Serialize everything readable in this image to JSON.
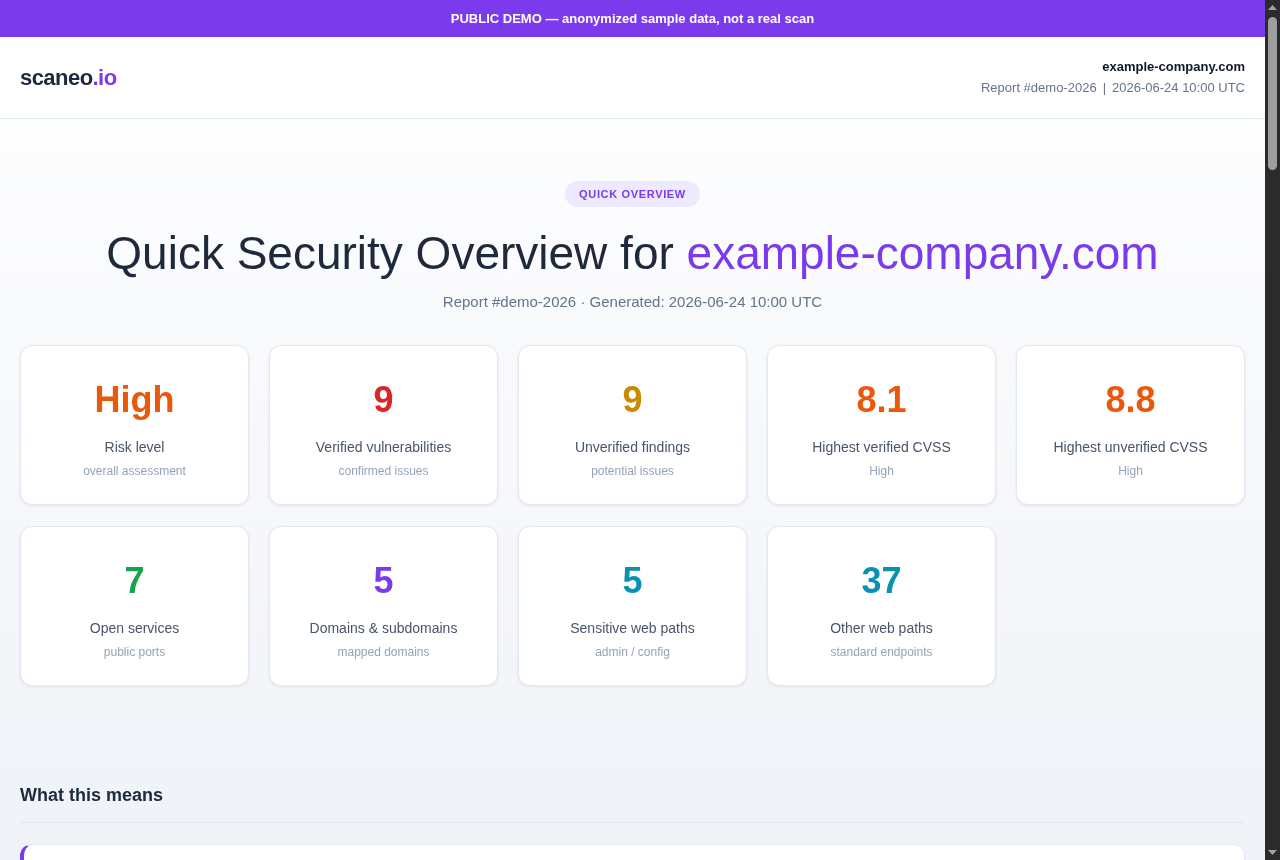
{
  "banner": {
    "text": "PUBLIC DEMO — anonymized sample data, not a real scan"
  },
  "header": {
    "logo": {
      "name": "scaneo",
      "tld": ".io"
    },
    "domain": "example-company.com",
    "meta": [
      "Report #demo-2026",
      "2026-06-24 10:00 UTC"
    ],
    "meta_separator": "|"
  },
  "hero": {
    "badge": "QUICK OVERVIEW",
    "title": "Quick Security Overview for",
    "title_domain": "example-company.com",
    "subtitle": "Report #demo-2026 · Generated: 2026-06-24 10:00 UTC"
  },
  "stats": [
    {
      "value": "High",
      "label": "Risk level",
      "note": "overall assessment",
      "color": "#ea580c"
    },
    {
      "value": "9",
      "label": "Verified vulnerabilities",
      "note": "confirmed issues",
      "color": "#dc2626"
    },
    {
      "value": "9",
      "label": "Unverified findings",
      "note": "potential issues",
      "color": "#ca8a04"
    },
    {
      "value": "8.1",
      "label": "Highest verified CVSS",
      "note": "High",
      "color": "#ea580c"
    },
    {
      "value": "8.8",
      "label": "Highest unverified CVSS",
      "note": "High",
      "color": "#ea580c"
    },
    {
      "value": "7",
      "label": "Open services",
      "note": "public ports",
      "color": "#16a34a"
    },
    {
      "value": "5",
      "label": "Domains & subdomains",
      "note": "mapped domains",
      "color": "#7c3aed"
    },
    {
      "value": "5",
      "label": "Sensitive web paths",
      "note": "admin / config",
      "color": "#0891b2"
    },
    {
      "value": "37",
      "label": "Other web paths",
      "note": "standard endpoints",
      "color": "#0891b2"
    }
  ],
  "explanation": {
    "heading": "What this means"
  }
}
